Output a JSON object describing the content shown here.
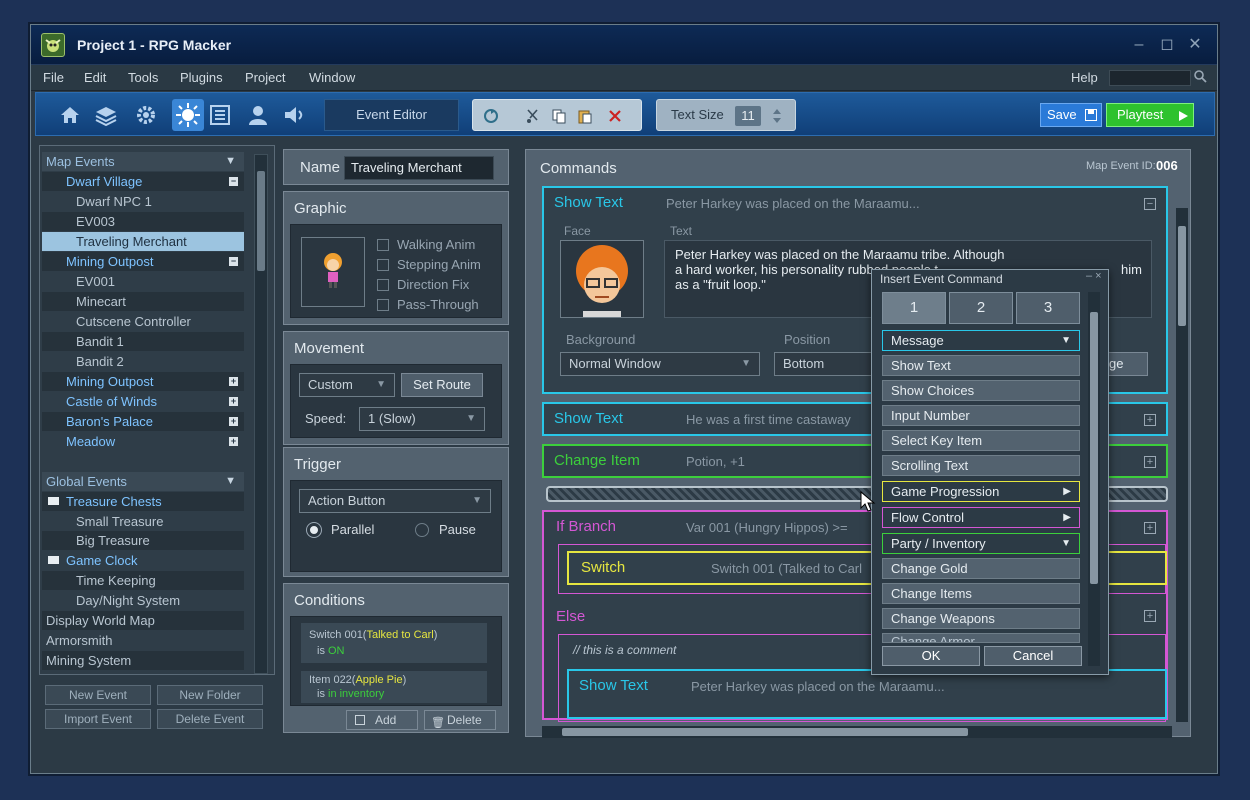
{
  "app": {
    "title": "Project 1 - RPG Macker"
  },
  "window_controls": {
    "minimize": "‒",
    "maximize": "◻",
    "close": "✕"
  },
  "menubar": {
    "items": [
      "File",
      "Edit",
      "Tools",
      "Plugins",
      "Project",
      "Window"
    ],
    "help": "Help"
  },
  "toolbar": {
    "event_editor": "Event Editor",
    "text_size_label": "Text Size",
    "text_size_value": "11",
    "save": "Save",
    "playtest": "Playtest"
  },
  "map_events": {
    "header": "Map Events",
    "dwarf_village": "Dwarf Village",
    "dwarf_items": [
      "Dwarf NPC 1",
      "EV003",
      "Traveling Merchant"
    ],
    "mining_outpost": "Mining Outpost",
    "mining_items": [
      "EV001",
      "Minecart",
      "Cutscene Controller",
      "Bandit 1",
      "Bandit 2"
    ],
    "collapsed": [
      "Mining Outpost",
      "Castle of Winds",
      "Baron's Palace",
      "Meadow"
    ]
  },
  "global_events": {
    "header": "Global Events",
    "treasure_folder": "Treasure Chests",
    "treasure_items": [
      "Small Treasure",
      "Big Treasure"
    ],
    "clock_folder": "Game Clock",
    "clock_items": [
      "Time Keeping",
      "Day/Night System"
    ],
    "root_items": [
      "Display World Map",
      "Armorsmith",
      "Mining System"
    ]
  },
  "left_buttons": {
    "new_event": "New Event",
    "new_folder": "New Folder",
    "import_event": "Import Event",
    "delete_event": "Delete Event"
  },
  "event": {
    "name_label": "Name",
    "name_value": "Traveling Merchant",
    "graphic_title": "Graphic",
    "graphic_options": [
      "Walking Anim",
      "Stepping Anim",
      "Direction Fix",
      "Pass-Through"
    ],
    "movement_title": "Movement",
    "movement_type": "Custom",
    "set_route": "Set Route",
    "speed_label": "Speed:",
    "speed_value": "1 (Slow)",
    "trigger_title": "Trigger",
    "trigger_value": "Action Button",
    "trigger_parallel": "Parallel",
    "trigger_pause": "Pause",
    "conditions_title": "Conditions",
    "cond1_a": "Switch 001(",
    "cond1_hl": "Talked to Carl",
    "cond1_b": ")",
    "cond1_is": "is ",
    "cond1_val": "ON",
    "cond2_a": "Item 022(",
    "cond2_hl": "Apple Pie",
    "cond2_b": ")",
    "cond2_is": "is ",
    "cond2_val": "in inventory",
    "add": "Add",
    "delete": "Delete"
  },
  "commands": {
    "title": "Commands",
    "map_event_id_label": "Map Event ID:",
    "map_event_id": "006",
    "show_text_1": {
      "title": "Show Text",
      "desc": "Peter Harkey was placed on the Maraamu...",
      "face_label": "Face",
      "text_label": "Text",
      "text": "Peter Harkey was placed on the Maraamu tribe. Although a hard worker, his personality rubbed people t",
      "text_tail": "him",
      "text_line3": "as a \"fruit loop.\"",
      "background_label": "Background",
      "background_value": "Normal Window",
      "position_label": "Position",
      "position_value": "Bottom",
      "partial_button": "ge"
    },
    "show_text_2": {
      "title": "Show Text",
      "desc": "He was a first time castaway"
    },
    "change_item": {
      "title": "Change Item",
      "desc": "Potion, +1"
    },
    "if_branch": {
      "title": "If Branch",
      "desc": "Var 001 (Hungry Hippos)  >="
    },
    "switch": {
      "title": "Switch",
      "desc": "Switch 001 (Talked to Carl"
    },
    "else": "Else",
    "comment": "// this is a comment",
    "show_text_3": {
      "title": "Show Text",
      "desc": "Peter Harkey was placed on the Maraamu..."
    }
  },
  "dialog": {
    "title": "Insert Event Command",
    "tabs": [
      "1",
      "2",
      "3"
    ],
    "message_cat": "Message",
    "message_items": [
      "Show Text",
      "Show Choices",
      "Input Number",
      "Select Key Item",
      "Scrolling Text"
    ],
    "game_progression": "Game Progression",
    "flow_control": "Flow Control",
    "party_inventory": "Party / Inventory",
    "party_items": [
      "Change Gold",
      "Change Items",
      "Change Weapons",
      "Change Armor"
    ],
    "ok": "OK",
    "cancel": "Cancel"
  },
  "colors": {
    "cyan": "#29c7e8",
    "green": "#3ccf3c",
    "pink": "#d457d4",
    "yellow": "#e6e640",
    "accent_blue": "#2a7ad8"
  }
}
